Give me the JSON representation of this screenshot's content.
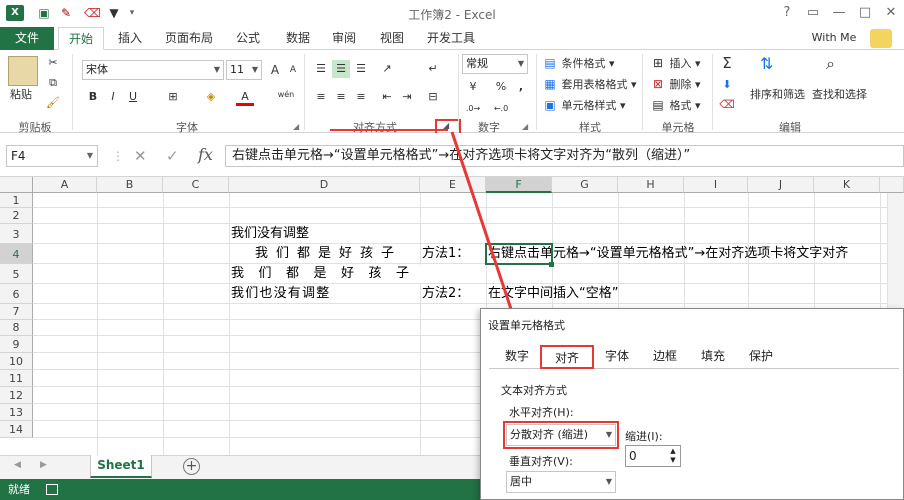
{
  "titlebar": {
    "title": "工作簿2 - Excel",
    "app_icon": "X",
    "help": "?",
    "restore": "▭",
    "minimize": "—",
    "maximize": "□",
    "close": "✕"
  },
  "quick_access": {
    "save_icon": "save-icon",
    "undo_icon": "undo-icon",
    "redo_icon": "redo-icon",
    "filter_icon": "filter-icon"
  },
  "tabs": [
    "文件",
    "开始",
    "插入",
    "页面布局",
    "公式",
    "数据",
    "审阅",
    "视图",
    "开发工具"
  ],
  "user": "With Me",
  "ribbon": {
    "clipboard": {
      "paste": "粘贴",
      "label": "剪贴板"
    },
    "font": {
      "name": "宋体",
      "size": "11",
      "bold": "B",
      "italic": "I",
      "underline": "U",
      "grow": "A",
      "shrink": "A",
      "color": "A",
      "wen": "wén",
      "label": "字体"
    },
    "align": {
      "label": "对齐方式"
    },
    "number": {
      "format": "常规",
      "currency": "¥",
      "percent": "%",
      "comma": ",",
      "label": "数字"
    },
    "styles": {
      "conditional": "条件格式",
      "table": "套用表格格式",
      "cell": "单元格样式",
      "label": "样式"
    },
    "cells": {
      "insert": "插入",
      "delete": "删除",
      "format": "格式",
      "label": "单元格"
    },
    "editing": {
      "sum": "Σ",
      "sort": "排序和筛选",
      "find": "查找和选择",
      "label": "编辑"
    }
  },
  "formula_bar": {
    "name_box": "F4",
    "fx": "fx",
    "cancel": "✕",
    "enter": "✓",
    "formula": "右键点击单元格→“设置单元格格式”→在对齐选项卡将文字对齐为“散列（缩进）”"
  },
  "columns": [
    "A",
    "B",
    "C",
    "D",
    "E",
    "F",
    "G",
    "H",
    "I",
    "J",
    "K"
  ],
  "rows": [
    "1",
    "2",
    "3",
    "4",
    "5",
    "6",
    "7",
    "8",
    "9",
    "10",
    "11",
    "12",
    "13",
    "14"
  ],
  "cells": {
    "d3": "我们没有调整",
    "d4": "我们都是好孩子",
    "d5": "我们都是好孩子",
    "d6": "我们也没有调整",
    "e4": "方法1：",
    "e6": "方法2：",
    "f4": "右键点击单元格→“设置单元格格式”→在对齐选项卡将文字对齐",
    "f6": "在文字中间插入“空格”"
  },
  "sheets": {
    "active": "Sheet1",
    "add": "+"
  },
  "status": {
    "text": "就绪"
  },
  "dialog": {
    "title": "设置单元格格式",
    "tabs": [
      "数字",
      "对齐",
      "字体",
      "边框",
      "填充",
      "保护"
    ],
    "section": "文本对齐方式",
    "horizontal_label": "水平对齐(H):",
    "horizontal_value": "分散对齐 (缩进)",
    "indent_label": "缩进(I):",
    "indent_value": "0",
    "vertical_label": "垂直对齐(V):",
    "vertical_value": "居中"
  },
  "colors": {
    "excel_green": "#217346",
    "highlight_red": "#e53935"
  }
}
